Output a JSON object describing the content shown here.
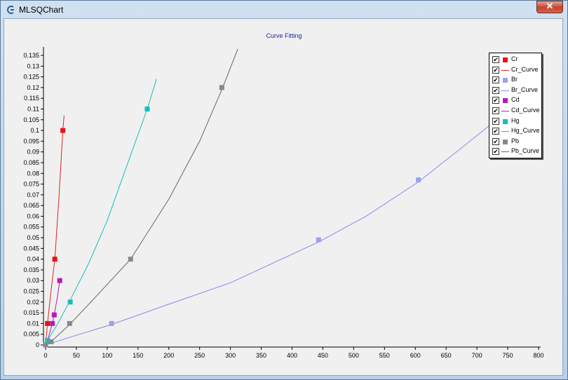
{
  "window": {
    "title": "MLSQChart",
    "close_glyph": "✕"
  },
  "chart_data": {
    "type": "scatter",
    "title": "Curve Fitting",
    "xlabel": "",
    "ylabel": "",
    "xlim": [
      0,
      800
    ],
    "ylim": [
      0,
      0.135
    ],
    "x_ticks": [
      0,
      50,
      100,
      150,
      200,
      250,
      300,
      350,
      400,
      450,
      500,
      550,
      600,
      650,
      700,
      750,
      800
    ],
    "y_ticks": [
      0,
      0.005,
      0.01,
      0.015,
      0.02,
      0.025,
      0.03,
      0.035,
      0.04,
      0.045,
      0.05,
      0.055,
      0.06,
      0.065,
      0.07,
      0.075,
      0.08,
      0.085,
      0.09,
      0.095,
      0.1,
      0.105,
      0.11,
      0.115,
      0.12,
      0.125,
      0.13,
      0.135
    ],
    "grid": false,
    "legend_position": "top-right",
    "series": [
      {
        "name": "Cr",
        "kind": "points",
        "color": "#ee1111",
        "points": [
          [
            0,
            0
          ],
          [
            3,
            0.01
          ],
          [
            15,
            0.04
          ],
          [
            28,
            0.1
          ]
        ]
      },
      {
        "name": "Cr_Curve",
        "kind": "curve",
        "color": "#dd2222",
        "points": [
          [
            0,
            0
          ],
          [
            3,
            0.0095
          ],
          [
            8,
            0.023
          ],
          [
            15,
            0.04
          ],
          [
            22,
            0.07
          ],
          [
            28,
            0.1
          ],
          [
            30,
            0.107
          ]
        ]
      },
      {
        "name": "Br",
        "kind": "points",
        "color": "#9aa0f5",
        "points": [
          [
            0,
            0
          ],
          [
            107,
            0.01
          ],
          [
            443,
            0.049
          ],
          [
            605,
            0.077
          ],
          [
            732,
            0.107
          ]
        ]
      },
      {
        "name": "Br_Curve",
        "kind": "curve",
        "color": "#8888ee",
        "points": [
          [
            0,
            0
          ],
          [
            50,
            0.0045
          ],
          [
            107,
            0.0095
          ],
          [
            200,
            0.019
          ],
          [
            300,
            0.029
          ],
          [
            443,
            0.048
          ],
          [
            520,
            0.06
          ],
          [
            605,
            0.076
          ],
          [
            680,
            0.093
          ],
          [
            732,
            0.105
          ],
          [
            800,
            0.123
          ]
        ]
      },
      {
        "name": "Cd",
        "kind": "points",
        "color": "#b21bb8",
        "points": [
          [
            0,
            0
          ],
          [
            11,
            0.01
          ],
          [
            14,
            0.014
          ],
          [
            23,
            0.03
          ]
        ]
      },
      {
        "name": "Cd_Curve",
        "kind": "curve",
        "color": "#b21bb8",
        "points": [
          [
            0,
            0
          ],
          [
            5,
            0.004
          ],
          [
            11,
            0.01
          ],
          [
            14,
            0.014
          ],
          [
            19,
            0.022
          ],
          [
            23,
            0.03
          ]
        ]
      },
      {
        "name": "Hg",
        "kind": "points",
        "color": "#19bcbc",
        "points": [
          [
            0,
            0
          ],
          [
            3,
            0.002
          ],
          [
            40,
            0.02
          ],
          [
            165,
            0.11
          ]
        ]
      },
      {
        "name": "Hg_Curve",
        "kind": "curve",
        "color": "#19bcbc",
        "points": [
          [
            0,
            0
          ],
          [
            3,
            0.002
          ],
          [
            20,
            0.01
          ],
          [
            40,
            0.021
          ],
          [
            70,
            0.038
          ],
          [
            100,
            0.058
          ],
          [
            130,
            0.082
          ],
          [
            165,
            0.11
          ],
          [
            180,
            0.124
          ]
        ]
      },
      {
        "name": "Pb",
        "kind": "points",
        "color": "#888888",
        "points": [
          [
            0,
            0
          ],
          [
            9,
            0.0015
          ],
          [
            39,
            0.01
          ],
          [
            138,
            0.04
          ],
          [
            286,
            0.12
          ]
        ]
      },
      {
        "name": "Pb_Curve",
        "kind": "curve",
        "color": "#666666",
        "points": [
          [
            0,
            0
          ],
          [
            9,
            0.0015
          ],
          [
            39,
            0.0095
          ],
          [
            80,
            0.022
          ],
          [
            138,
            0.04
          ],
          [
            200,
            0.068
          ],
          [
            250,
            0.095
          ],
          [
            286,
            0.119
          ],
          [
            312,
            0.138
          ]
        ]
      }
    ]
  },
  "legend": [
    {
      "label": "Cr",
      "kind": "points",
      "color": "#ee1111",
      "checked": "✔"
    },
    {
      "label": "Cr_Curve",
      "kind": "curve",
      "color": "#dd2222",
      "checked": "✔"
    },
    {
      "label": "Br",
      "kind": "points",
      "color": "#9aa0f5",
      "checked": "✔"
    },
    {
      "label": "Br_Curve",
      "kind": "curve",
      "color": "#8888ee",
      "checked": "✔"
    },
    {
      "label": "Cd",
      "kind": "points",
      "color": "#b21bb8",
      "checked": "✔"
    },
    {
      "label": "Cd_Curve",
      "kind": "curve",
      "color": "#b21bb8",
      "checked": "✔"
    },
    {
      "label": "Hg",
      "kind": "points",
      "color": "#19bcbc",
      "checked": "✔"
    },
    {
      "label": "Hg_Curve",
      "kind": "curve",
      "color": "#19bcbc",
      "checked": "✔"
    },
    {
      "label": "Pb",
      "kind": "points",
      "color": "#888888",
      "checked": "✔"
    },
    {
      "label": "Pb_Curve",
      "kind": "curve",
      "color": "#666666",
      "checked": "✔"
    }
  ]
}
